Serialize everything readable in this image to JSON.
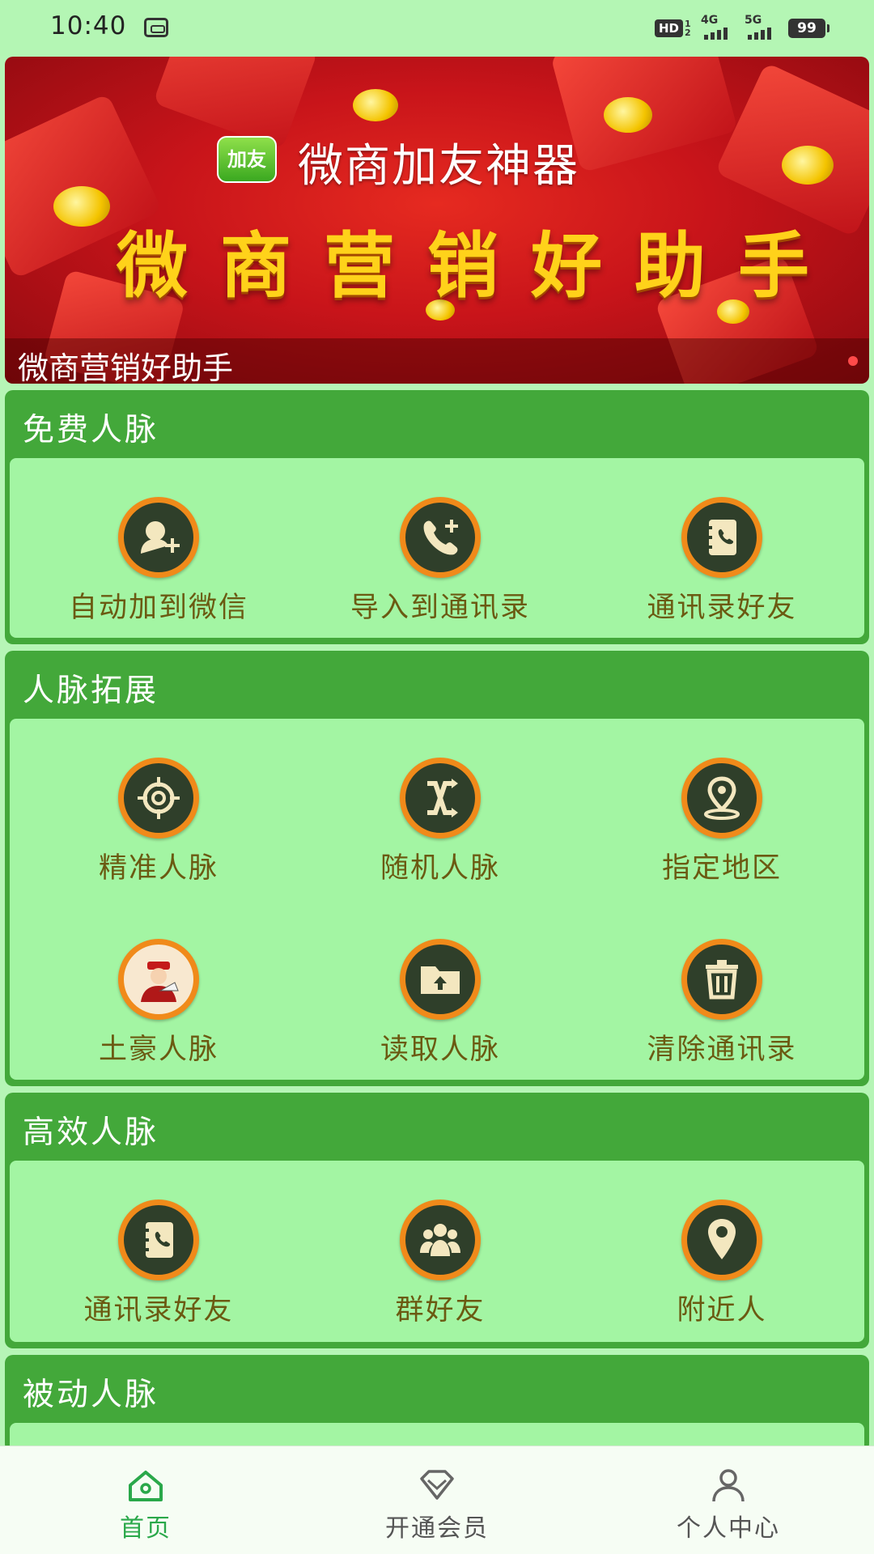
{
  "status_bar": {
    "time": "10:40",
    "hd_label": "HD",
    "hd_sub": "1 2",
    "signal_1": "4G",
    "signal_2": "5G",
    "battery": "99"
  },
  "banner": {
    "logo_text": "加友",
    "title": "微商加友神器",
    "slogan": "微商营销好助手",
    "caption": "微商营销好助手"
  },
  "sections": [
    {
      "title": "免费人脉",
      "rows": [
        [
          {
            "label": "自动加到微信",
            "icon": "add-contact-icon"
          },
          {
            "label": "导入到通讯录",
            "icon": "phone-add-icon"
          },
          {
            "label": "通讯录好友",
            "icon": "address-book-icon"
          }
        ]
      ]
    },
    {
      "title": "人脉拓展",
      "rows": [
        [
          {
            "label": "精准人脉",
            "icon": "crosshair-icon"
          },
          {
            "label": "随机人脉",
            "icon": "shuffle-icon"
          },
          {
            "label": "指定地区",
            "icon": "location-icon"
          }
        ],
        [
          {
            "label": "土豪人脉",
            "icon": "rich-man-icon"
          },
          {
            "label": "读取人脉",
            "icon": "folder-upload-icon"
          },
          {
            "label": "清除通讯录",
            "icon": "trash-icon"
          }
        ]
      ]
    },
    {
      "title": "高效人脉",
      "rows": [
        [
          {
            "label": "通讯录好友",
            "icon": "address-book-icon"
          },
          {
            "label": "群好友",
            "icon": "group-icon"
          },
          {
            "label": "附近人",
            "icon": "map-pin-icon"
          }
        ]
      ]
    },
    {
      "title": "被动人脉",
      "rows": []
    }
  ],
  "bottom_nav": [
    {
      "label": "首页",
      "icon": "home-icon",
      "active": true
    },
    {
      "label": "开通会员",
      "icon": "diamond-icon",
      "active": false
    },
    {
      "label": "个人中心",
      "icon": "user-icon",
      "active": false
    }
  ],
  "colors": {
    "section_header": "#43a83a",
    "panel": "#a3f5a3",
    "icon_ring": "#f08a1a",
    "icon_fill": "#2f3f2a",
    "label_text": "#6b5a12",
    "nav_active": "#2aa84a"
  }
}
